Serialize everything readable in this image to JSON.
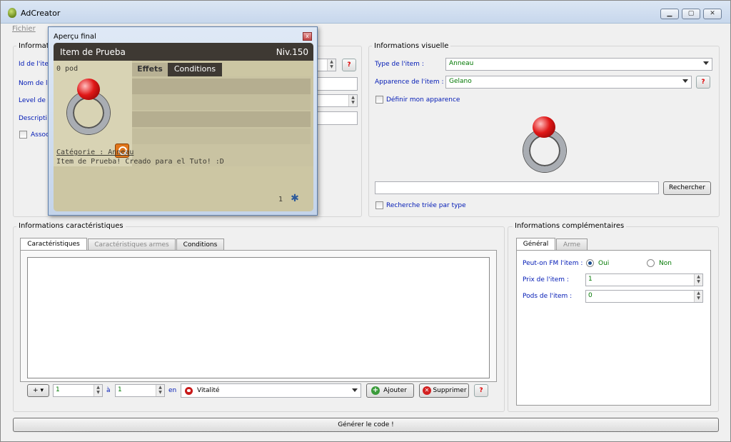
{
  "window": {
    "title": "AdCreator",
    "minimize": "▁",
    "maximize": "▢",
    "close": "✕"
  },
  "menu": {
    "file": "Fichier"
  },
  "left_group": {
    "title": "Informati",
    "id_label": "Id de l'ite",
    "name_label": "Nom de l'",
    "level_label": "Level de",
    "desc_label": "Descripti",
    "assoc_label": "Assoc",
    "help": "?"
  },
  "visual": {
    "title": "Informations visuelle",
    "type_label": "Type de l'item :",
    "type_value": "Anneau",
    "appearance_label": "Apparence de l'item :",
    "appearance_value": "Gelano",
    "define_label": "Définir mon apparence",
    "search_value": "",
    "search_button": "Rechercher",
    "sorted_label": "Recherche triée par type",
    "help": "?"
  },
  "characteristics": {
    "title": "Informations caractéristiques",
    "tabs": [
      "Caractéristiques",
      "Caractéristiques armes",
      "Conditions"
    ],
    "add_label": "+",
    "from_value": "1",
    "to_label": "à",
    "to_value": "1",
    "in_label": "en",
    "stat_value": "Vitalité",
    "add_button": "Ajouter",
    "delete_button": "Supprimer",
    "help": "?"
  },
  "complementary": {
    "title": "Informations complémentaires",
    "tabs": [
      "Général",
      "Arme"
    ],
    "fm_label": "Peut-on FM l'item :",
    "yes": "Oui",
    "no": "Non",
    "price_label": "Prix de l'item :",
    "price_value": "1",
    "pods_label": "Pods de l'item :",
    "pods_value": "0"
  },
  "generate_button": "Générer le code !",
  "preview": {
    "title": "Aperçu final",
    "close": "x",
    "item_name": "Item de Prueba",
    "level": "Niv.150",
    "pods": "0 pod",
    "tab_effects": "Effets",
    "tab_conditions": "Conditions",
    "category": "Catégorie : Anneau",
    "description": "Item de Prueba! Creado para el Tuto! :D",
    "count": "1"
  },
  "colors": {
    "label_blue": "#0019b5",
    "value_green": "#007000",
    "card_bg": "#ccc6a3",
    "card_header": "#3e3933"
  }
}
